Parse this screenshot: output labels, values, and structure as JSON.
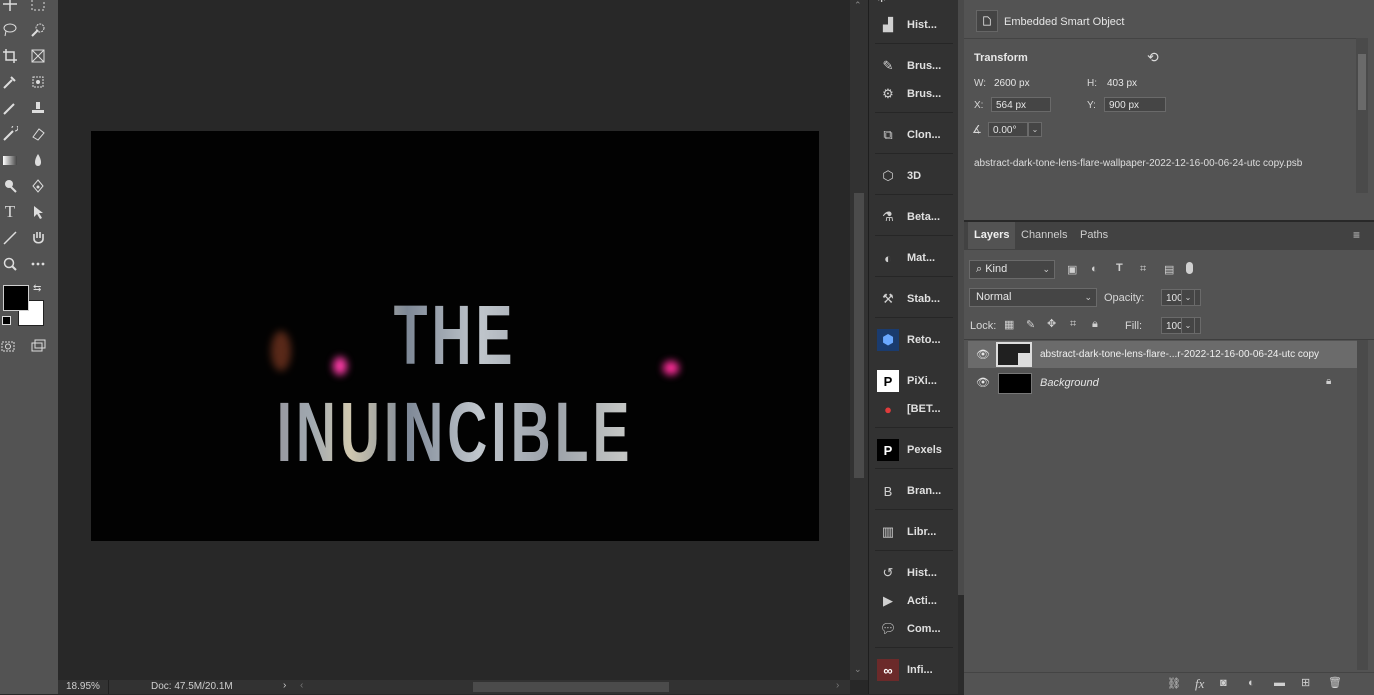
{
  "document": {
    "title_text": "THE INUINCIBLE"
  },
  "status": {
    "zoom": "18.95%",
    "doc_size": "Doc: 47.5M/20.1M"
  },
  "dock": {
    "items": [
      {
        "label": "Hist...",
        "icon": "histogram-icon"
      },
      {
        "label": "Brus...",
        "icon": "brush-icon"
      },
      {
        "label": "Brus...",
        "icon": "brush-settings-icon"
      },
      {
        "label": "Clon...",
        "icon": "clone-source-icon"
      },
      {
        "label": "3D",
        "icon": "cube-icon"
      },
      {
        "label": "Beta...",
        "icon": "flask-icon"
      },
      {
        "label": "Mat...",
        "icon": "materials-icon"
      },
      {
        "label": "Stab...",
        "icon": "robot-arm-icon"
      },
      {
        "label": "Reto...",
        "icon": "retouch-icon"
      },
      {
        "label": "PiXi...",
        "icon": "pixi-icon"
      },
      {
        "label": "[BET...",
        "icon": "red-circle-icon"
      },
      {
        "label": "Pexels",
        "icon": "pexels-icon"
      },
      {
        "label": "Bran...",
        "icon": "brand-b-icon"
      },
      {
        "label": "Libr...",
        "icon": "libraries-icon"
      },
      {
        "label": "Hist...",
        "icon": "history-icon"
      },
      {
        "label": "Acti...",
        "icon": "play-icon"
      },
      {
        "label": "Com...",
        "icon": "comment-icon"
      },
      {
        "label": "Infi...",
        "icon": "infinite-icon"
      }
    ]
  },
  "properties": {
    "object_type": "Embedded Smart Object",
    "transform_label": "Transform",
    "w_label": "W:",
    "w_value": "2600 px",
    "h_label": "H:",
    "h_value": "403 px",
    "x_label": "X:",
    "x_value": "564 px",
    "y_label": "Y:",
    "y_value": "900 px",
    "angle_value": "0.00°",
    "filename": "abstract-dark-tone-lens-flare-wallpaper-2022-12-16-00-06-24-utc copy.psb"
  },
  "layers_panel": {
    "tabs": [
      "Layers",
      "Channels",
      "Paths"
    ],
    "filter_kind": "Kind",
    "blend_mode": "Normal",
    "opacity_label": "Opacity:",
    "opacity_value": "100%",
    "lock_label": "Lock:",
    "fill_label": "Fill:",
    "fill_value": "100%",
    "layers": [
      {
        "name": "abstract-dark-tone-lens-flare-...r-2022-12-16-00-06-24-utc copy",
        "selected": true
      },
      {
        "name": "Background",
        "selected": false,
        "locked": true
      }
    ]
  },
  "colors": {
    "panel": "#535353",
    "canvas_bg": "#282828",
    "dock_bg": "#323232",
    "foreground_swatch": "#000000",
    "background_swatch": "#ffffff"
  }
}
